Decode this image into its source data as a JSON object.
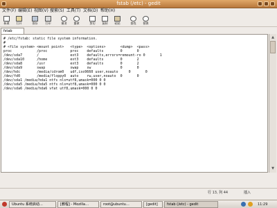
{
  "window": {
    "title": "fstab (/etc) - gedit"
  },
  "menubar": {
    "items": [
      "文件(F)",
      "编辑(E)",
      "视图(V)",
      "搜索(S)",
      "工具(T)",
      "文档(D)",
      "帮助(H)"
    ]
  },
  "toolbar": {
    "buttons": [
      {
        "id": "new",
        "label": "新建"
      },
      {
        "id": "open",
        "label": "打开"
      },
      {
        "id": "save",
        "label": "保存"
      },
      {
        "id": "print",
        "label": "打印"
      },
      {
        "id": "undo",
        "label": "撤消"
      },
      {
        "id": "redo",
        "label": "重做"
      },
      {
        "id": "cut",
        "label": "剪切"
      },
      {
        "id": "copy",
        "label": "复制"
      },
      {
        "id": "paste",
        "label": "粘贴"
      },
      {
        "id": "find",
        "label": "查找"
      },
      {
        "id": "replace",
        "label": "替换"
      }
    ]
  },
  "tab": {
    "label": "fstab"
  },
  "editor": {
    "lines": [
      "# /etc/fstab: static file system information.",
      "#",
      "# <file system> <mount point>   <type>  <options>       <dump>  <pass>",
      "proc            /proc           proc    defaults        0       0",
      "/dev/sda7       /               ext3    defaults,errors=remount-ro 0       1",
      "/dev/sda10      /home           ext3    defaults        0       2",
      "/dev/sda8       /usr            ext3    defaults        0       2",
      "/dev/sda9       swap            swap    sw              0       0",
      "/dev/hdc        /media/cdrom0   udf,iso9660 user,noauto     0       0",
      "/dev/fd0        /media/floppy0  auto    rw,user,noauto  0       0",
      "/dev/sda1 /media/hda1 ntfs nls=utf8,umask=000 0 0",
      "/dev/sda5 /media/hda5 ntfs nls=utf8,umask=000 0 0",
      "/dev/sda6 /media/hda6 vfat utf8,umask=000 0 0"
    ]
  },
  "statusbar": {
    "position": "行 13, 列 44",
    "mode": "插入"
  },
  "panel": {
    "tasks": [
      {
        "label": "Ubuntu 系统启动…"
      },
      {
        "label": "[教程] - Mozilla…"
      },
      {
        "label": "root@ubuntu…"
      },
      {
        "label": "[gedit]"
      },
      {
        "label": "fstab (/etc) - gedit"
      }
    ],
    "clock": "11:29"
  },
  "colors": {
    "title_bar": "#c8894a",
    "panel": "#e7e2dc"
  }
}
